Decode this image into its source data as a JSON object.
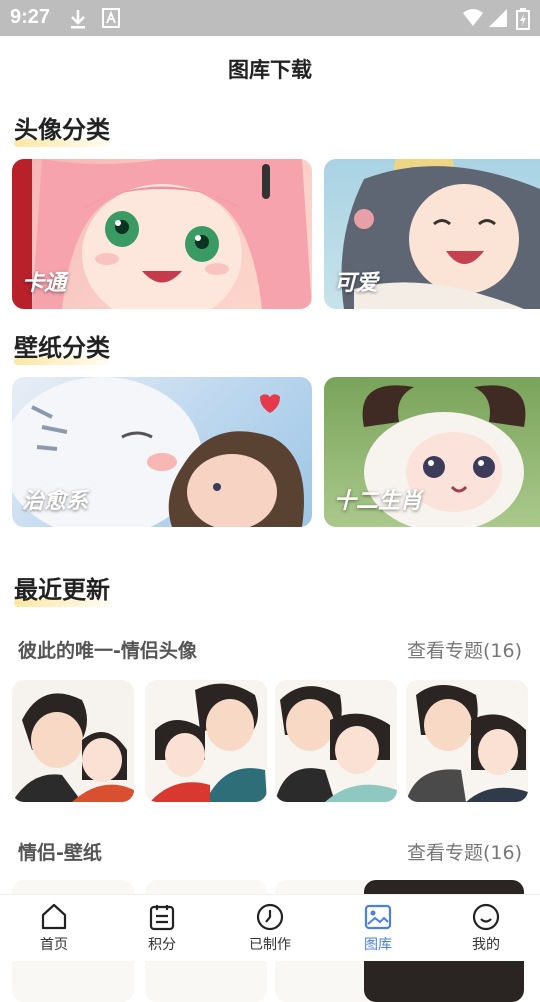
{
  "statusbar": {
    "time": "9:27"
  },
  "header": {
    "title": "图库下载"
  },
  "avatar_section": {
    "title": "头像分类",
    "cards": [
      {
        "label": "卡通"
      },
      {
        "label": "可爱"
      }
    ]
  },
  "wallpaper_section": {
    "title": "壁纸分类",
    "cards": [
      {
        "label": "治愈系"
      },
      {
        "label": "十二生肖"
      }
    ]
  },
  "recent": {
    "title": "最近更新",
    "groups": [
      {
        "title": "彼此的唯一-情侣头像",
        "link": "查看专题(16)"
      },
      {
        "title": "情侣-壁纸",
        "link": "查看专题(16)"
      }
    ]
  },
  "tabs": [
    {
      "label": "首页",
      "icon": "home-icon"
    },
    {
      "label": "积分",
      "icon": "points-icon"
    },
    {
      "label": "已制作",
      "icon": "clock-icon"
    },
    {
      "label": "图库",
      "icon": "gallery-icon"
    },
    {
      "label": "我的",
      "icon": "profile-icon"
    }
  ],
  "colors": {
    "accent": "#4a7ee8",
    "statusbar": "#bdbdbd"
  }
}
